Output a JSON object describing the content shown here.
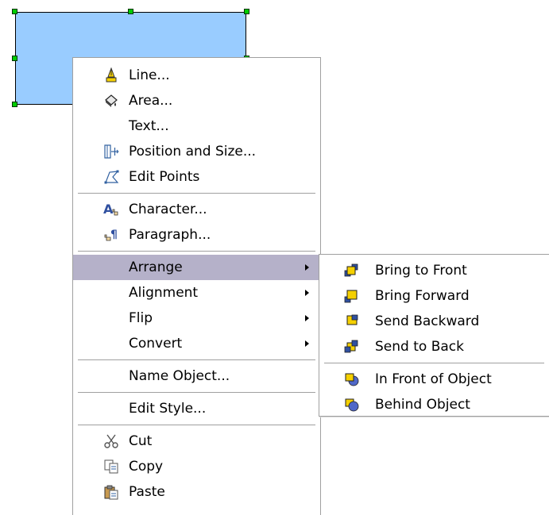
{
  "colors": {
    "shape_fill": "#99ccff",
    "handle": "#00cc00",
    "highlight": "#b5b1c9",
    "separator": "#a0a0a0"
  },
  "context_menu": {
    "items": [
      {
        "label": "Line...",
        "icon": "line-icon"
      },
      {
        "label": "Area...",
        "icon": "area-icon"
      },
      {
        "label": "Text..."
      },
      {
        "label": "Position and Size...",
        "icon": "position-size-icon"
      },
      {
        "label": "Edit Points",
        "icon": "edit-points-icon"
      },
      {
        "label": "Character...",
        "icon": "character-icon"
      },
      {
        "label": "Paragraph...",
        "icon": "paragraph-icon"
      },
      {
        "label": "Arrange",
        "submenu": true,
        "highlighted": true
      },
      {
        "label": "Alignment",
        "submenu": true
      },
      {
        "label": "Flip",
        "submenu": true
      },
      {
        "label": "Convert",
        "submenu": true
      },
      {
        "label": "Name Object..."
      },
      {
        "label": "Edit Style..."
      },
      {
        "label": "Cut",
        "icon": "scissors-icon"
      },
      {
        "label": "Copy",
        "icon": "copy-icon"
      },
      {
        "label": "Paste",
        "icon": "paste-icon"
      }
    ]
  },
  "arrange_submenu": {
    "items": [
      {
        "label": "Bring to Front",
        "icon": "bring-to-front-icon"
      },
      {
        "label": "Bring Forward",
        "icon": "bring-forward-icon"
      },
      {
        "label": "Send Backward",
        "icon": "send-backward-icon"
      },
      {
        "label": "Send to Back",
        "icon": "send-to-back-icon"
      },
      {
        "label": "In Front of Object",
        "icon": "in-front-of-object-icon"
      },
      {
        "label": "Behind Object",
        "icon": "behind-object-icon"
      }
    ]
  }
}
